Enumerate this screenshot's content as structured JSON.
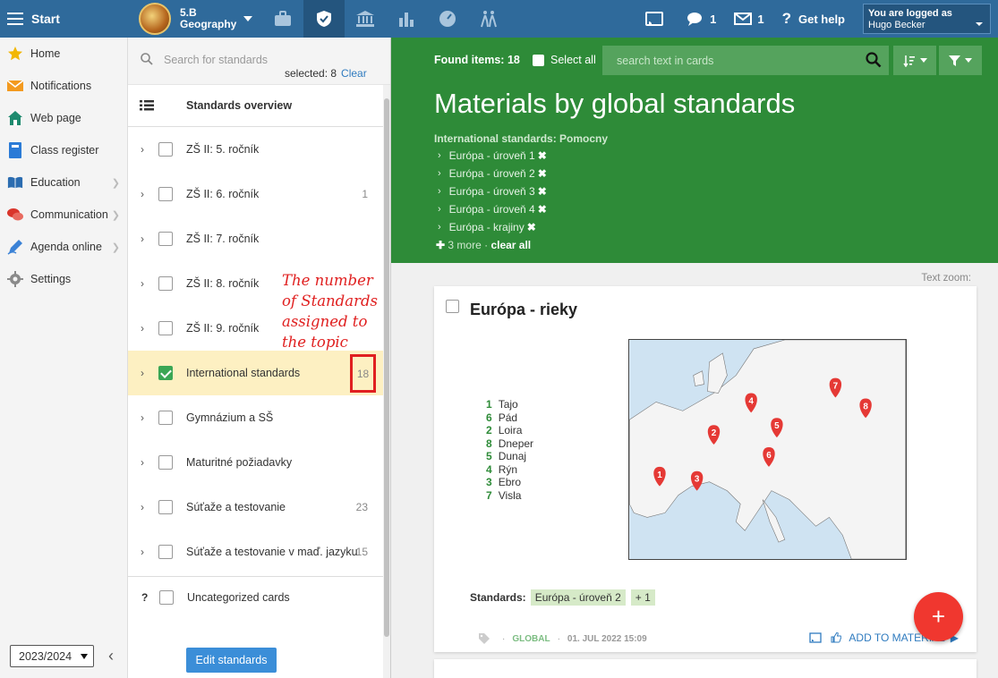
{
  "topbar": {
    "start_label": "Start",
    "class_line1": "5.B",
    "class_line2": "Geography",
    "messages_count": "1",
    "mail_count": "1",
    "help_label": "Get help",
    "logged_as_label": "You are logged as",
    "user_name": "Hugo Becker"
  },
  "sidebar": {
    "items": [
      {
        "label": "Home",
        "icon": "star-icon"
      },
      {
        "label": "Notifications",
        "icon": "envelope-icon"
      },
      {
        "label": "Web page",
        "icon": "house-icon"
      },
      {
        "label": "Class register",
        "icon": "book-icon"
      },
      {
        "label": "Education",
        "icon": "open-book-icon"
      },
      {
        "label": "Communication",
        "icon": "chat-icon"
      },
      {
        "label": "Agenda online",
        "icon": "pen-icon"
      },
      {
        "label": "Settings",
        "icon": "gear-icon"
      }
    ],
    "year": "2023/2024"
  },
  "standards": {
    "search_placeholder": "Search for standards",
    "selected_text": "selected: 8",
    "clear_label": "Clear",
    "overview_label": "Standards overview",
    "rows": [
      {
        "label": "ZŠ II: 5. ročník",
        "count": ""
      },
      {
        "label": "ZŠ II: 6. ročník",
        "count": "1"
      },
      {
        "label": "ZŠ II: 7. ročník",
        "count": ""
      },
      {
        "label": "ZŠ II: 8. ročník",
        "count": ""
      },
      {
        "label": "ZŠ II: 9. ročník",
        "count": ""
      },
      {
        "label": "International standards",
        "count": "18"
      },
      {
        "label": "Gymnázium a SŠ",
        "count": ""
      },
      {
        "label": "Maturitné požiadavky",
        "count": ""
      },
      {
        "label": "Súťaže a testovanie",
        "count": "23"
      },
      {
        "label": "Súťaže a testovanie v maď. jazyku",
        "count": "15"
      }
    ],
    "uncategorized_mark": "?",
    "uncategorized_label": "Uncategorized cards",
    "edit_button": "Edit standards",
    "annotation": "The number of Standards assigned to the topic"
  },
  "main": {
    "found_label": "Found items: 18",
    "select_all_label": "Select all",
    "search_placeholder": "search text in cards",
    "title": "Materials by global standards",
    "filter_heading": "International standards: Pomocny",
    "filters": [
      "Európa - úroveň 1",
      "Európa - úroveň 2",
      "Európa - úroveň 3",
      "Európa - úroveň 4",
      "Európa - krajiny"
    ],
    "more_label": "3 more",
    "clear_all_label": "clear all",
    "text_zoom_label": "Text zoom:"
  },
  "card": {
    "title": "Európa - rieky",
    "legend": [
      {
        "n": "1",
        "name": "Tajo"
      },
      {
        "n": "6",
        "name": "Pád"
      },
      {
        "n": "2",
        "name": "Loira"
      },
      {
        "n": "8",
        "name": "Dneper"
      },
      {
        "n": "5",
        "name": "Dunaj"
      },
      {
        "n": "4",
        "name": "Rýn"
      },
      {
        "n": "3",
        "name": "Ebro"
      },
      {
        "n": "7",
        "name": "Visla"
      }
    ],
    "standards_label": "Standards:",
    "standard_tag": "Európa - úroveň 2",
    "more_tag": "+ 1",
    "footer_scope": "GLOBAL",
    "footer_date": "01. JUL 2022 15:09",
    "add_material_label": "ADD TO MATERIAL"
  },
  "fab_label": "+",
  "colors": {
    "topbar": "#2f6a9b",
    "green_header": "#2e8b38",
    "highlight_row": "#fdf0c2",
    "annotation_red": "#e02020",
    "fab": "#f0372f"
  }
}
